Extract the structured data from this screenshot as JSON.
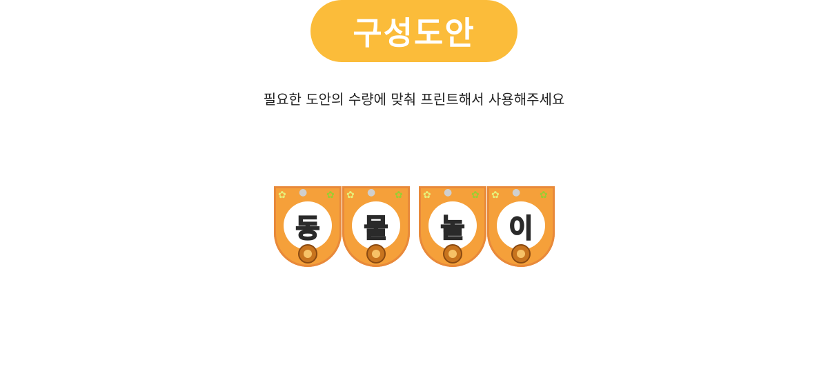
{
  "title": "구성도안",
  "subtitle": "필요한 도안의 수량에 맞춰 프린트해서 사용해주세요",
  "colors": {
    "title_pill": "#fbbc3a",
    "banner_bg": "#f5a03a"
  },
  "banners": [
    {
      "letter": "동",
      "color": "#f7a83a"
    },
    {
      "letter": "물",
      "color": "#2d8de0"
    },
    {
      "letter": "놀",
      "color": "#f08a6a"
    },
    {
      "letter": "이",
      "color": "#9acd32"
    }
  ]
}
